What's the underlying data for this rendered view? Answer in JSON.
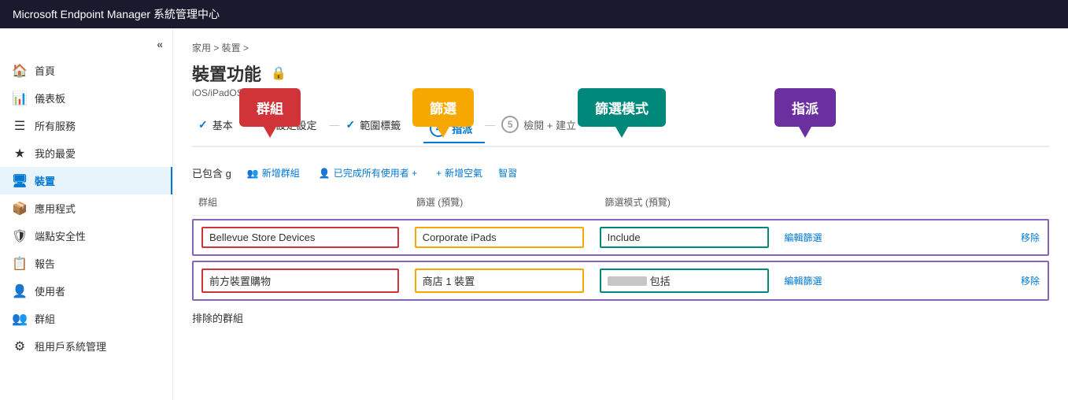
{
  "topbar": {
    "title": "Microsoft Endpoint Manager 系統管理中心"
  },
  "sidebar": {
    "collapse_label": "«",
    "items": [
      {
        "id": "home",
        "label": "首頁",
        "icon": "🏠",
        "active": false
      },
      {
        "id": "dashboard",
        "label": "儀表板",
        "icon": "📊",
        "active": false
      },
      {
        "id": "all-services",
        "label": "所有服務",
        "icon": "☰",
        "active": false
      },
      {
        "id": "favorites",
        "label": "我的最愛",
        "icon": "★",
        "active": false
      },
      {
        "id": "devices",
        "label": "裝置",
        "icon": "🖥",
        "active": true
      },
      {
        "id": "apps",
        "label": "應用程式",
        "icon": "📦",
        "active": false
      },
      {
        "id": "endpoint-security",
        "label": "端點安全性",
        "icon": "🛡",
        "active": false
      },
      {
        "id": "reports",
        "label": "報告",
        "icon": "📋",
        "active": false
      },
      {
        "id": "users",
        "label": "使用者",
        "icon": "👤",
        "active": false
      },
      {
        "id": "groups",
        "label": "群組",
        "icon": "👥",
        "active": false
      },
      {
        "id": "tenant-admin",
        "label": "租用戶系統管理",
        "icon": "⚙",
        "active": false
      }
    ]
  },
  "breadcrumb": {
    "text": "家用 &gt; 裝置 &gt;"
  },
  "page": {
    "title": "裝置功能",
    "subtitle": "iOS/iPadOS",
    "lock_icon": "🔒"
  },
  "wizard": {
    "steps": [
      {
        "id": "basics",
        "label": "基本",
        "state": "completed",
        "number": ""
      },
      {
        "id": "config",
        "label": "設定設定",
        "state": "completed",
        "number": ""
      },
      {
        "id": "scope-tags",
        "label": "範圍標籤",
        "state": "completed",
        "number": ""
      },
      {
        "id": "assign",
        "label": "指派",
        "state": "active",
        "number": "4"
      },
      {
        "id": "review",
        "label": "檢閱 + 建立",
        "state": "inactive",
        "number": "5"
      }
    ]
  },
  "assignment": {
    "included_label": "已包含 g",
    "add_group_label": "新增群組",
    "add_all_users_label": "已完成所有使用者 +",
    "add_blank_label": "新增空氣",
    "smart_label": "智習",
    "columns": {
      "group": "群組",
      "filter": "篩選 (預覽)",
      "filter_mode": "篩選模式 (預覽)"
    },
    "rows": [
      {
        "group": "Bellevue Store Devices",
        "filter": "Corporate iPads",
        "filter_mode": "Include",
        "edit_filter": "編輯篩選",
        "remove": "移除"
      },
      {
        "group": "前方裝置購物",
        "filter": "商店 1  裝置",
        "filter_mode": "包括",
        "edit_filter": "編輯篩選",
        "remove": "移除"
      }
    ],
    "exclude_label": "排除的群組"
  },
  "callouts": {
    "group": "群組",
    "filter": "篩選",
    "filter_mode": "篩選模式",
    "assign": "指派"
  }
}
